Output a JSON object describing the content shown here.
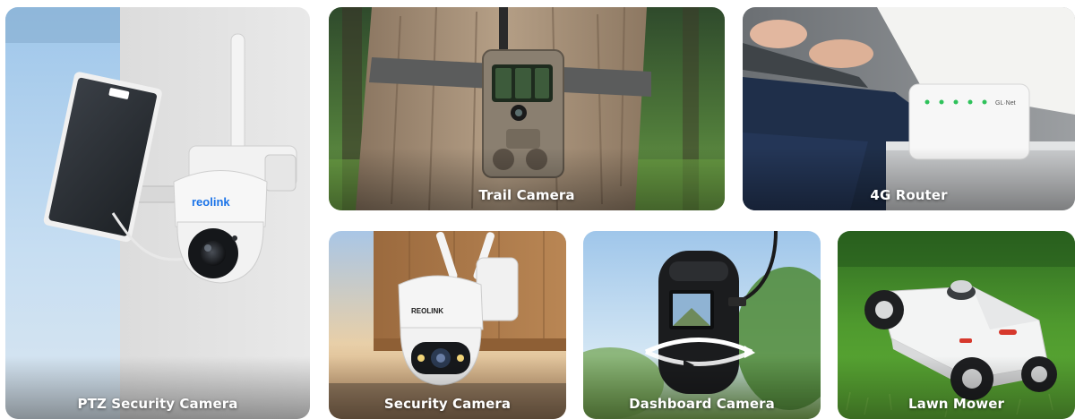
{
  "categories": [
    {
      "id": "ptz",
      "label": "PTZ Security Camera",
      "brand_mark": "reolink"
    },
    {
      "id": "trail",
      "label": "Trail Camera"
    },
    {
      "id": "router",
      "label": "4G Router",
      "device_text": "GL·Net"
    },
    {
      "id": "security",
      "label": "Security Camera",
      "brand_mark": "REOLINK"
    },
    {
      "id": "dash",
      "label": "Dashboard Camera"
    },
    {
      "id": "mower",
      "label": "Lawn Mower"
    }
  ],
  "colors": {
    "label_text": "#ffffff",
    "brand_blue": "#1a73e8",
    "grass": "#4f9a2e",
    "sky": "#b9d8f2"
  }
}
